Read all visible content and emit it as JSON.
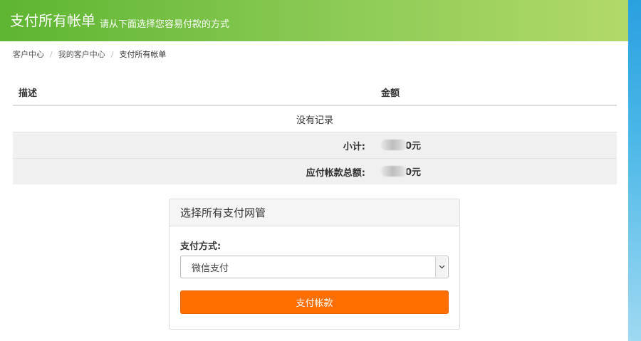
{
  "header": {
    "title": "支付所有帐单",
    "subtitle": "请从下面选择您容易付款的方式"
  },
  "breadcrumb": {
    "items": [
      "客户中心",
      "我的客户中心",
      "支付所有帐单"
    ],
    "separator": "/"
  },
  "table": {
    "columns": [
      "描述",
      "金额"
    ],
    "empty_text": "没有记录",
    "summary": [
      {
        "label": "小计:",
        "amount_suffix": "0元"
      },
      {
        "label": "应付帐款总额:",
        "amount_suffix": "0元"
      }
    ]
  },
  "payment_panel": {
    "title": "选择所有支付网管",
    "method_label": "支付方式:",
    "selected_method": "微信支付",
    "pay_button": "支付帐款"
  },
  "colors": {
    "header_start": "#5eb531",
    "header_end": "#b2d968",
    "pay_button": "#ff6f00"
  },
  "icons": {
    "select_arrow": "chevron-down-icon"
  }
}
